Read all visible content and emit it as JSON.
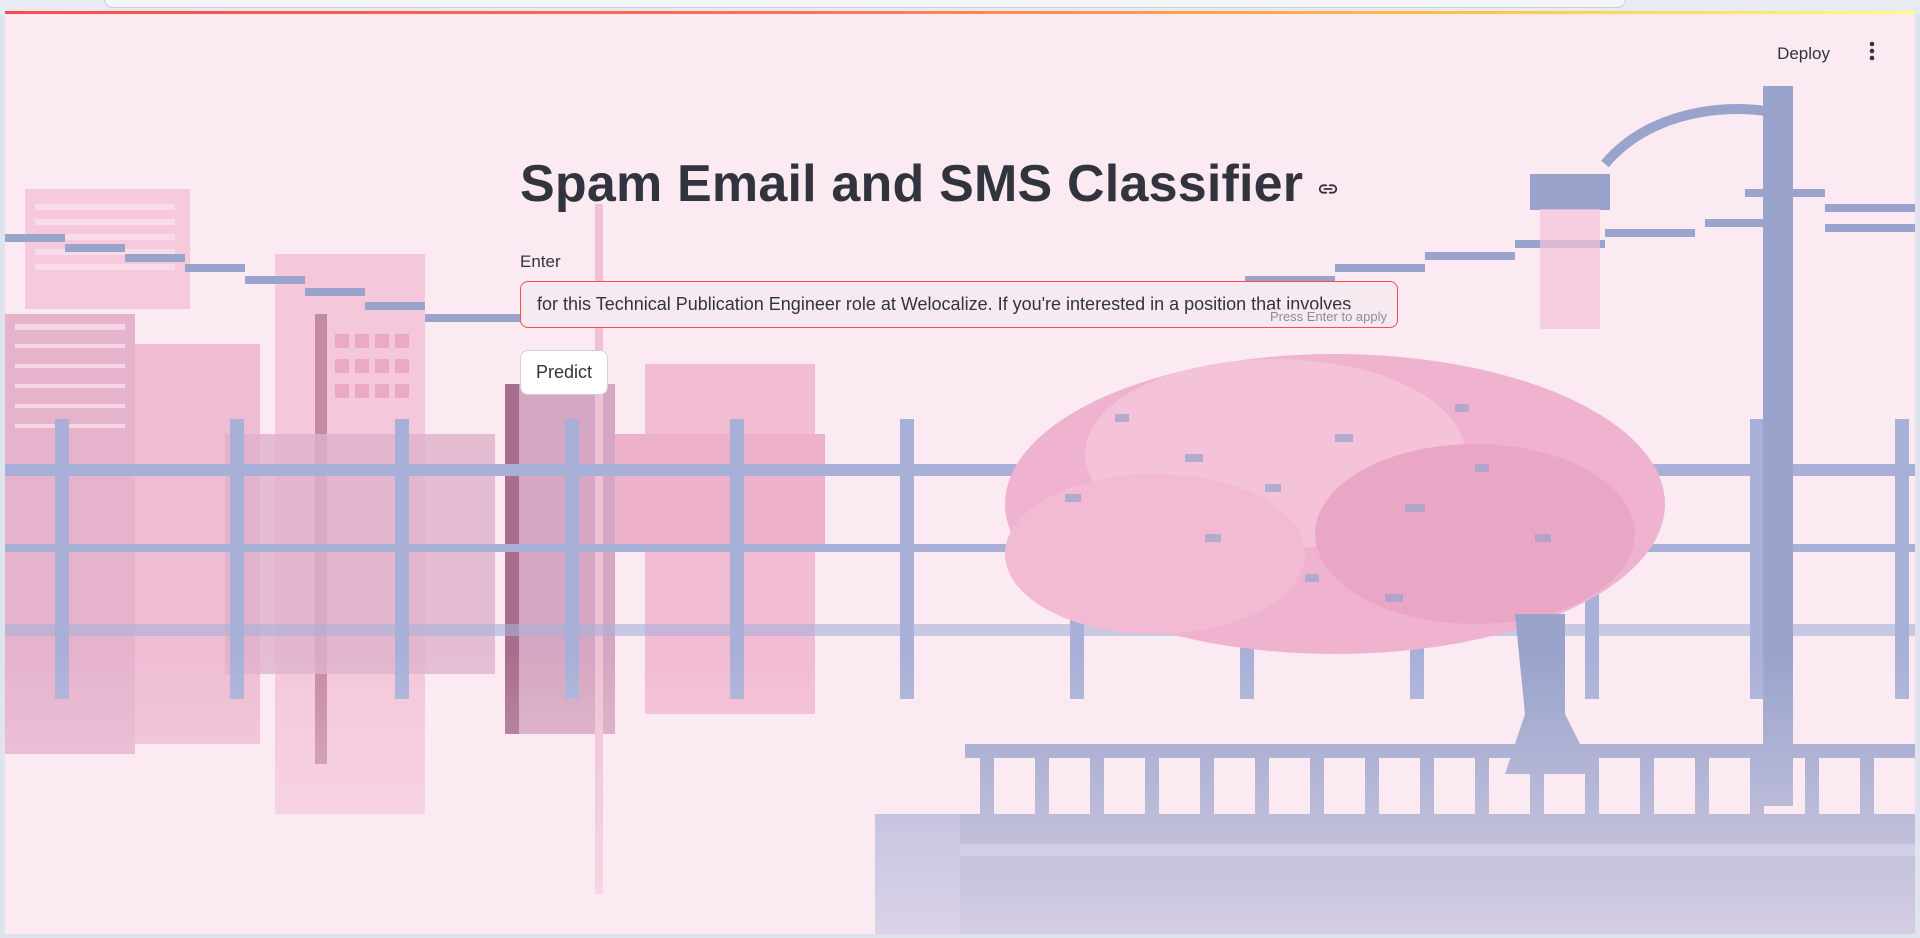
{
  "header": {
    "deploy_label": "Deploy",
    "menu_icon": "more-vertical-icon"
  },
  "main": {
    "title": "Spam Email and SMS Classifier",
    "title_link_icon": "link-icon",
    "input": {
      "label": "Enter",
      "value": "for this Technical Publication Engineer role at Welocalize. If you're interested in a position that involves",
      "hint": "Press Enter to apply"
    },
    "predict_label": "Predict"
  },
  "colors": {
    "accent": "#ff4b4b",
    "text": "#31333f",
    "background": "#fbeaf1",
    "scene_blue": "#9aa3cc",
    "scene_pink": "#f3b9d1"
  }
}
